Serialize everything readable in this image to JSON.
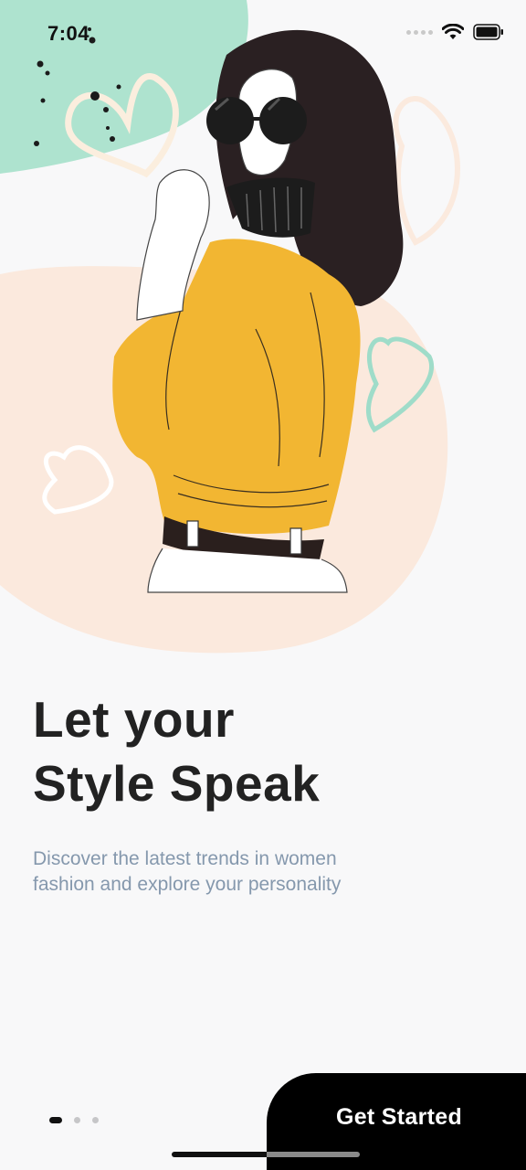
{
  "status_bar": {
    "time": "7:04"
  },
  "onboarding": {
    "headline_line1": "Let your",
    "headline_line2": "Style Speak",
    "subtitle_line1": "Discover the latest trends in women",
    "subtitle_line2": "fashion and explore your personality",
    "cta_label": "Get Started",
    "page_count": 3,
    "current_page": 1
  },
  "colors": {
    "mint_blob": "#aee3cf",
    "peach_blob": "#fbe9dd",
    "sweater": "#f2b632",
    "hair": "#2a2022",
    "headline": "#222222",
    "subtitle": "#8598ad",
    "cta_background": "#000000"
  }
}
